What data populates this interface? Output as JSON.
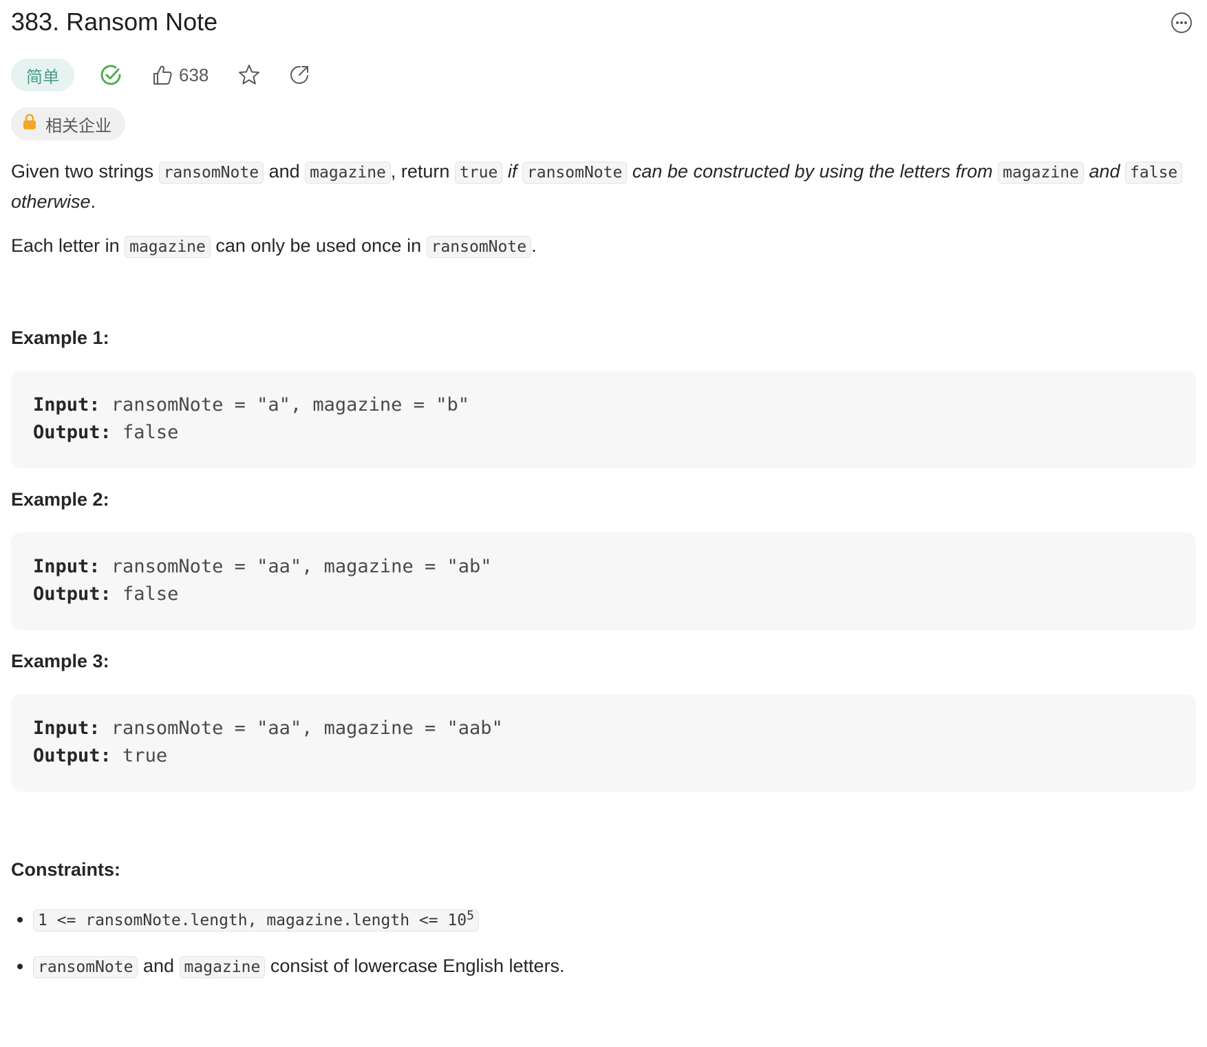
{
  "problem": {
    "title": "383. Ransom Note",
    "difficulty": "简单",
    "likes": "638",
    "companies_label": "相关企业"
  },
  "description": {
    "p1": {
      "t1": "Given two strings ",
      "c1": "ransomNote",
      "t2": " and ",
      "c2": "magazine",
      "t3": ", return ",
      "c3": "true",
      "t4": " ",
      "i1": "if",
      "t5": " ",
      "c4": "ransomNote",
      "t6": " ",
      "i2": "can be constructed by using the letters from",
      "t7": " ",
      "c5": "magazine",
      "t8": " ",
      "i3": "and",
      "t9": " ",
      "c6": "false",
      "t10": " ",
      "i4": "otherwise",
      "t11": "."
    },
    "p2": {
      "t1": "Each letter in ",
      "c1": "magazine",
      "t2": " can only be used once in ",
      "c2": "ransomNote",
      "t3": "."
    }
  },
  "examples": [
    {
      "title": "Example 1:",
      "input_label": "Input:",
      "input": " ransomNote = \"a\", magazine = \"b\"",
      "output_label": "Output:",
      "output": " false"
    },
    {
      "title": "Example 2:",
      "input_label": "Input:",
      "input": " ransomNote = \"aa\", magazine = \"ab\"",
      "output_label": "Output:",
      "output": " false"
    },
    {
      "title": "Example 3:",
      "input_label": "Input:",
      "input": " ransomNote = \"aa\", magazine = \"aab\"",
      "output_label": "Output:",
      "output": " true"
    }
  ],
  "constraints": {
    "title": "Constraints:",
    "c1_code": "1 <= ransomNote.length, magazine.length <= 10",
    "c1_sup": "5",
    "c2": {
      "c1": "ransomNote",
      "t1": " and ",
      "c2": "magazine",
      "t2": " consist of lowercase English letters."
    }
  },
  "colors": {
    "difficulty_text": "#4a9a8a",
    "difficulty_bg": "#e6f3f0",
    "solved_check": "#4caf50",
    "lock": "#f5a623"
  },
  "icons": {
    "more": "more-horizontal-icon",
    "solved": "check-circle-icon",
    "like": "thumbs-up-icon",
    "favorite": "star-icon",
    "share": "share-icon",
    "lock": "lock-icon"
  }
}
